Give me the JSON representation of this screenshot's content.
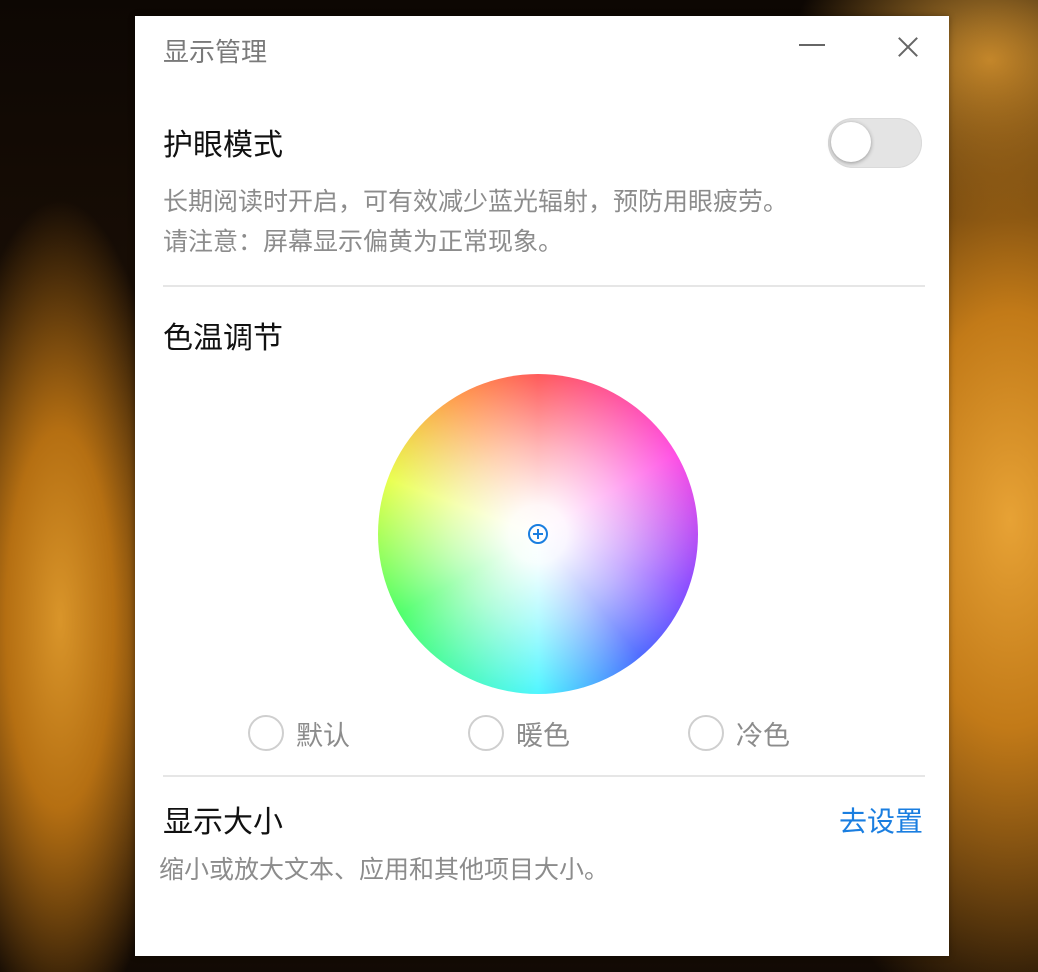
{
  "window": {
    "title": "显示管理"
  },
  "eye_mode": {
    "title": "护眼模式",
    "description_line1": "长期阅读时开启，可有效减少蓝光辐射，预防用眼疲劳。",
    "description_line2": "请注意：屏幕显示偏黄为正常现象。",
    "toggle_on": false
  },
  "color_temp": {
    "title": "色温调节",
    "options": [
      {
        "label": "默认",
        "selected": false
      },
      {
        "label": "暖色",
        "selected": false
      },
      {
        "label": "冷色",
        "selected": false
      }
    ]
  },
  "display_size": {
    "title": "显示大小",
    "link_label": "去设置",
    "description": "缩小或放大文本、应用和其他项目大小。"
  },
  "colors": {
    "accent": "#1a7ee0",
    "toggle_off": "#e4e4e4"
  }
}
